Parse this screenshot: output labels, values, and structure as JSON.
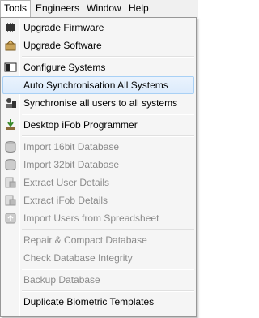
{
  "menubar": {
    "items": [
      {
        "label": "Tools",
        "active": true
      },
      {
        "label": "Engineers"
      },
      {
        "label": "Window"
      },
      {
        "label": "Help"
      }
    ]
  },
  "tools_menu": {
    "upgrade_firmware": "Upgrade Firmware",
    "upgrade_software": "Upgrade Software",
    "configure_systems": "Configure Systems",
    "auto_sync": "Auto Synchronisation All Systems",
    "sync_users": "Synchronise all users to all systems",
    "desktop_ifob": "Desktop iFob Programmer",
    "import_16bit": "Import 16bit Database",
    "import_32bit": "Import 32bit Database",
    "extract_user": "Extract User Details",
    "extract_ifob": "Extract iFob Details",
    "import_spreadsheet": "Import Users from Spreadsheet",
    "repair_compact": "Repair & Compact Database",
    "check_integrity": "Check Database Integrity",
    "backup": "Backup Database",
    "duplicate_biometric": "Duplicate Biometric Templates"
  },
  "colors": {
    "highlight_border": "#a8d0f5",
    "disabled_text": "#8a8a8a"
  }
}
